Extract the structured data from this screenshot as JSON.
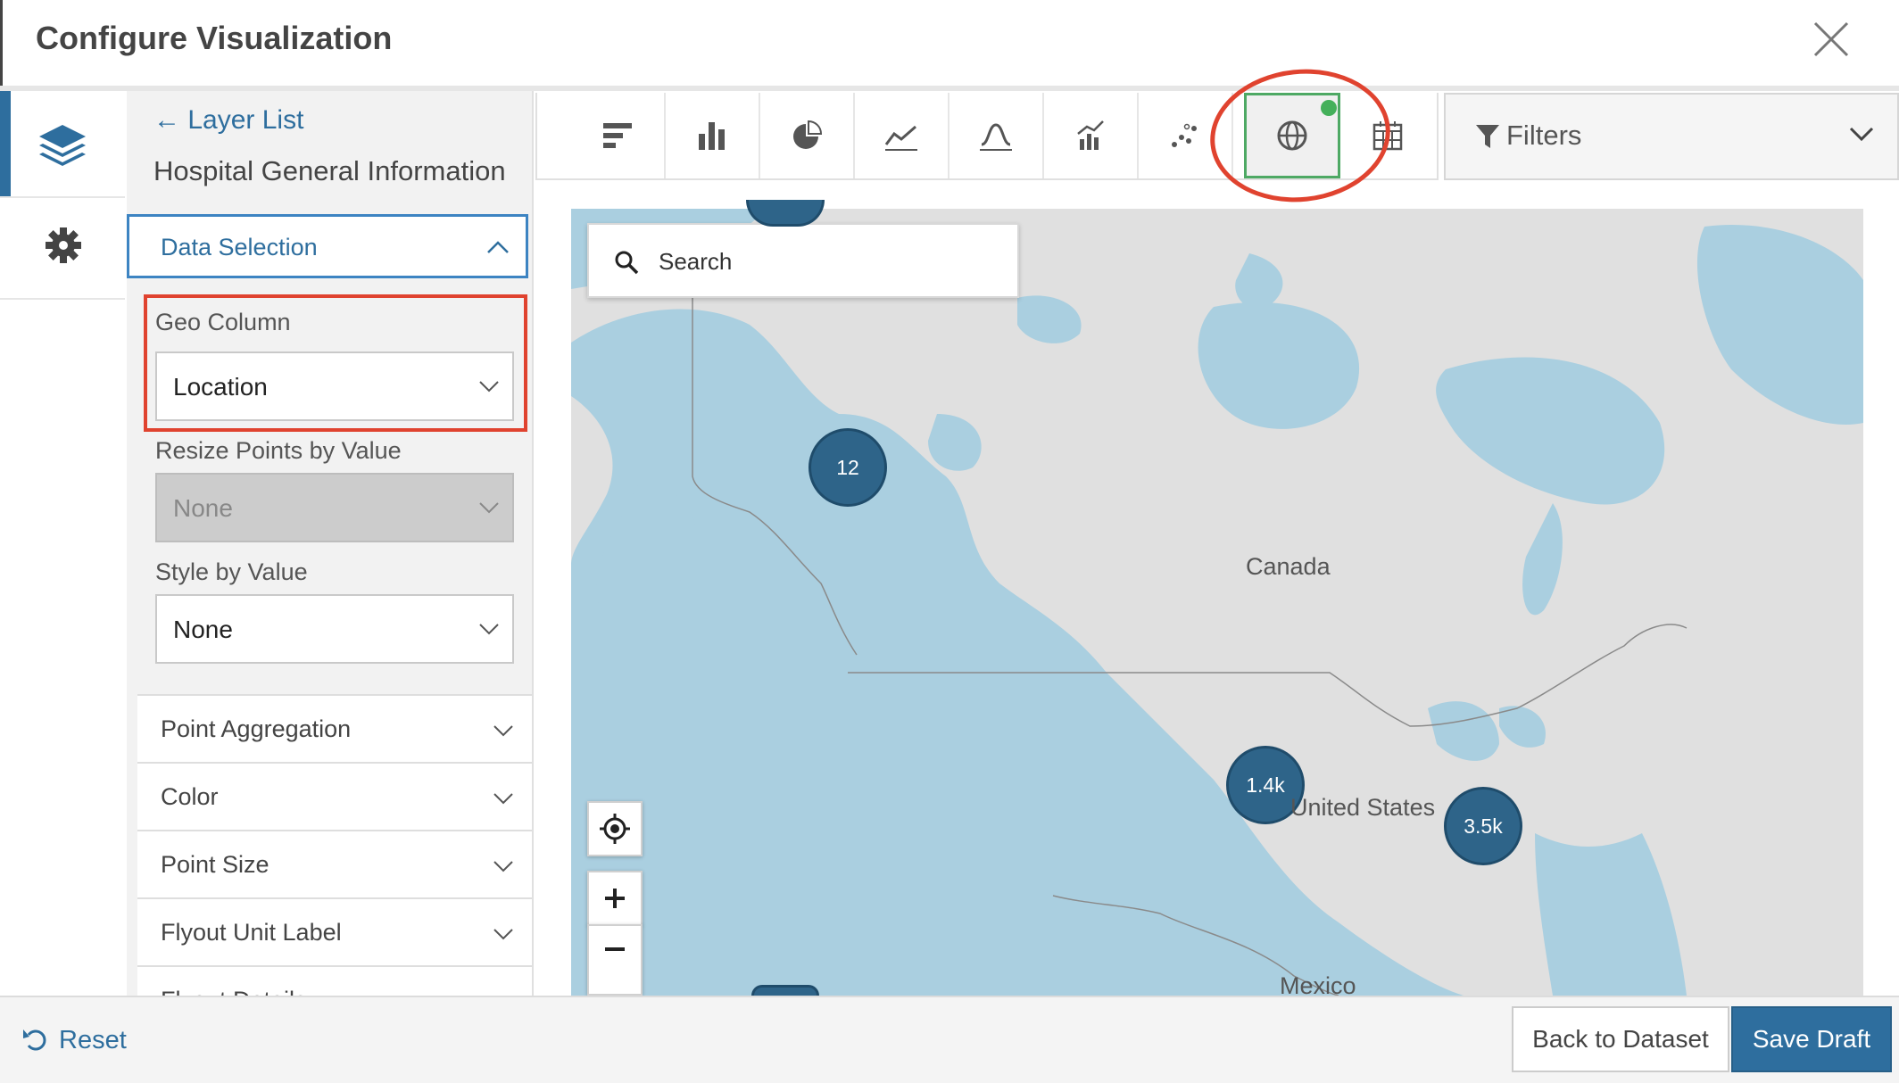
{
  "dialog": {
    "title": "Configure Visualization"
  },
  "panel": {
    "back_link": "Layer List",
    "layer_name": "Hospital General Information",
    "section_title": "Data Selection",
    "fields": {
      "geo_column": {
        "label": "Geo Column",
        "value": "Location"
      },
      "resize_points": {
        "label": "Resize Points by Value",
        "value": "None",
        "disabled": true
      },
      "style_by_value": {
        "label": "Style by Value",
        "value": "None"
      }
    },
    "accordion": [
      "Point Aggregation",
      "Color",
      "Point Size",
      "Flyout Unit Label",
      "Flyout Details"
    ]
  },
  "toolbar": {
    "chart_types": [
      "barchart-horizontal",
      "barchart-vertical",
      "pie-chart",
      "timeline",
      "histogram",
      "combo-chart",
      "scatter-chart",
      "map",
      "calendar"
    ],
    "selected": "map",
    "filters_label": "Filters"
  },
  "map": {
    "search_placeholder": "Search",
    "labels": {
      "canada": "Canada",
      "us": "United States",
      "mexico": "Mexico"
    },
    "clusters": [
      "12",
      "1.4k",
      "3.5k"
    ],
    "colors": {
      "water": "#aacfe0",
      "land": "#e0e0e0",
      "cluster": "#2e6489"
    }
  },
  "footer": {
    "reset_label": "Reset",
    "back_label": "Back to Dataset",
    "save_label": "Save Draft"
  },
  "colors": {
    "accent": "#2e6e9e",
    "annotation": "#e0432f",
    "active_green": "#4ea964"
  }
}
